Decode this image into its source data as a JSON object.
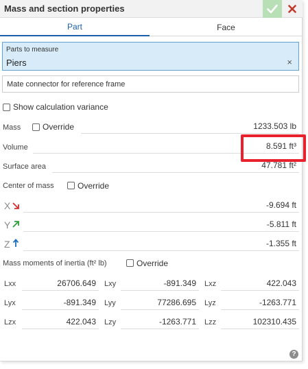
{
  "dialog": {
    "title": "Mass and section properties",
    "ok_icon": "checkmark-icon",
    "close_icon": "close-icon"
  },
  "tabs": [
    {
      "label": "Part",
      "active": true
    },
    {
      "label": "Face",
      "active": false
    }
  ],
  "parts_to_measure": {
    "label": "Parts to measure",
    "value": "Piers",
    "clear_glyph": "×"
  },
  "mate_connector": {
    "label": "Mate connector for reference frame"
  },
  "show_variance": {
    "label": "Show calculation variance",
    "checked": false
  },
  "mass": {
    "label": "Mass",
    "override_label": "Override",
    "value": "1233.503 lb"
  },
  "volume": {
    "label": "Volume",
    "value": "8.591 ft³"
  },
  "surface_area": {
    "label": "Surface area",
    "value": "47.781 ft²"
  },
  "center_of_mass": {
    "label": "Center of mass",
    "override_label": "Override",
    "x": {
      "label": "X",
      "value": "-9.694 ft",
      "color": "#d32f2f"
    },
    "y": {
      "label": "Y",
      "value": "-5.811 ft",
      "color": "#2e9e3a"
    },
    "z": {
      "label": "Z",
      "value": "-1.355 ft",
      "color": "#1e6fc2"
    }
  },
  "inertia": {
    "label": "Mass moments of inertia (ft² lb)",
    "override_label": "Override",
    "rows": [
      [
        {
          "label": "Lxx",
          "value": "26706.649"
        },
        {
          "label": "Lxy",
          "value": "-891.349"
        },
        {
          "label": "Lxz",
          "value": "422.043"
        }
      ],
      [
        {
          "label": "Lyx",
          "value": "-891.349"
        },
        {
          "label": "Lyy",
          "value": "77286.695"
        },
        {
          "label": "Lyz",
          "value": "-1263.771"
        }
      ],
      [
        {
          "label": "Lzx",
          "value": "422.043"
        },
        {
          "label": "Lzy",
          "value": "-1263.771"
        },
        {
          "label": "Lzz",
          "value": "102310.435"
        }
      ]
    ]
  },
  "help": {
    "glyph": "?"
  },
  "colors": {
    "accent": "#1a5fa8",
    "highlight": "#e8212d",
    "ok_bg": "#b9dfb6",
    "close": "#c0392b"
  }
}
